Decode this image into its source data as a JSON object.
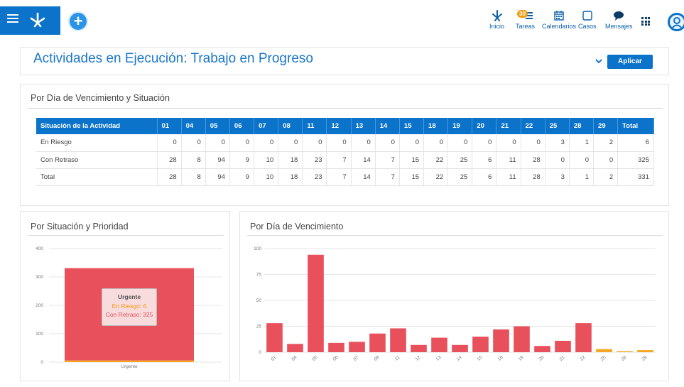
{
  "nav": {
    "inicio": "Inicio",
    "tareas": "Tareas",
    "tareas_badge": "30",
    "calendarios": "Calendarios",
    "casos": "Casos",
    "mensajes": "Mensajes"
  },
  "header": {
    "title": "Actividades en Ejecución: Trabajo en Progreso",
    "apply_label": "Aplicar"
  },
  "table_section": {
    "title": "Por Día de Vencimiento y Situación",
    "columns": [
      "Situación de la Actividad",
      "01",
      "04",
      "05",
      "06",
      "07",
      "08",
      "11",
      "12",
      "13",
      "14",
      "15",
      "18",
      "19",
      "20",
      "21",
      "22",
      "25",
      "28",
      "29",
      "Total"
    ],
    "rows": [
      {
        "label": "En Riesgo",
        "values": [
          "0",
          "0",
          "0",
          "0",
          "0",
          "0",
          "0",
          "0",
          "0",
          "0",
          "0",
          "0",
          "0",
          "0",
          "0",
          "0",
          "3",
          "1",
          "2",
          "6"
        ]
      },
      {
        "label": "Con Retraso",
        "values": [
          "28",
          "8",
          "94",
          "9",
          "10",
          "18",
          "23",
          "7",
          "14",
          "7",
          "15",
          "22",
          "25",
          "6",
          "11",
          "28",
          "0",
          "0",
          "0",
          "325"
        ]
      },
      {
        "label": "Total",
        "values": [
          "28",
          "8",
          "94",
          "9",
          "10",
          "18",
          "23",
          "7",
          "14",
          "7",
          "15",
          "22",
          "25",
          "6",
          "11",
          "28",
          "3",
          "1",
          "2",
          "331"
        ]
      }
    ]
  },
  "colors": {
    "brand": "#0b73c9",
    "en_riesgo": "#f5a623",
    "con_retraso": "#e8505b"
  },
  "chart_data": [
    {
      "type": "bar",
      "title": "Por Situación y Prioridad",
      "categories": [
        "Urgente"
      ],
      "stacked": true,
      "series": [
        {
          "name": "En Riesgo",
          "values": [
            6
          ],
          "color": "#f5a623"
        },
        {
          "name": "Con Retraso",
          "values": [
            325
          ],
          "color": "#e8505b"
        }
      ],
      "ylim": [
        0,
        400
      ],
      "yticks": [
        0,
        100,
        200,
        300,
        400
      ],
      "grid": true,
      "tooltip": {
        "title": "Urgente",
        "line1": "En Riesgo: 6",
        "line2": "Con Retraso: 325"
      }
    },
    {
      "type": "bar",
      "title": "Por Día de Vencimiento",
      "categories": [
        "01",
        "04",
        "05",
        "06",
        "07",
        "08",
        "11",
        "12",
        "13",
        "14",
        "15",
        "18",
        "19",
        "20",
        "21",
        "22",
        "25",
        "28",
        "29"
      ],
      "values": [
        28,
        8,
        94,
        9,
        10,
        18,
        23,
        7,
        14,
        7,
        15,
        22,
        25,
        6,
        11,
        28,
        3,
        1,
        2
      ],
      "bar_colors": [
        "#e8505b",
        "#e8505b",
        "#e8505b",
        "#e8505b",
        "#e8505b",
        "#e8505b",
        "#e8505b",
        "#e8505b",
        "#e8505b",
        "#e8505b",
        "#e8505b",
        "#e8505b",
        "#e8505b",
        "#e8505b",
        "#e8505b",
        "#e8505b",
        "#f5a623",
        "#f5a623",
        "#f5a623"
      ],
      "ylim": [
        0,
        100
      ],
      "yticks": [
        0,
        25,
        50,
        75,
        100
      ],
      "grid": true
    }
  ]
}
